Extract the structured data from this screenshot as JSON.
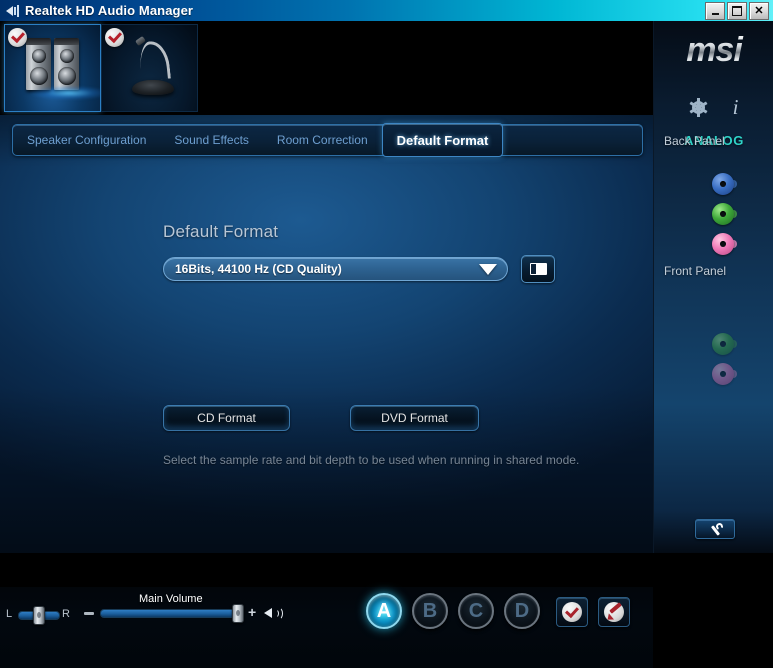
{
  "window": {
    "title": "Realtek HD Audio Manager",
    "icon": "speaker-icon",
    "controls": {
      "minimize": "_",
      "maximize": "□",
      "close": "✕"
    }
  },
  "device_tabs": [
    {
      "name": "speakers",
      "icon": "speakers-icon",
      "badge": "check-badge",
      "selected": true
    },
    {
      "name": "microphone",
      "icon": "microphone-icon",
      "badge": "check-badge",
      "selected": false
    }
  ],
  "tabs": [
    {
      "label": "Speaker Configuration",
      "active": false
    },
    {
      "label": "Sound Effects",
      "active": false
    },
    {
      "label": "Room Correction",
      "active": false
    },
    {
      "label": "Default Format",
      "active": true
    }
  ],
  "main": {
    "section_title": "Default Format",
    "format_select": {
      "value": "16Bits, 44100 Hz (CD Quality)",
      "caret": "chevron-down-icon"
    },
    "test_button": "test-tone-icon",
    "cd_format_label": "CD Format",
    "dvd_format_label": "DVD Format",
    "hint": "Select the sample rate and bit depth to be used when running in shared mode."
  },
  "bottom": {
    "balance": {
      "left_label": "L",
      "right_label": "R",
      "value": 50
    },
    "main_volume": {
      "label": "Main Volume",
      "minus": "minus-icon",
      "plus": "+",
      "speaker_icon": "volume-speaker-icon",
      "value": 100
    },
    "profiles": [
      {
        "label": "A",
        "active": true
      },
      {
        "label": "B",
        "active": false
      },
      {
        "label": "C",
        "active": false
      },
      {
        "label": "D",
        "active": false
      }
    ],
    "actions": [
      {
        "name": "apply",
        "icon": "check-disc-icon"
      },
      {
        "name": "edit",
        "icon": "pen-disc-icon"
      }
    ]
  },
  "sidebar": {
    "brand": "msi",
    "icons": [
      {
        "name": "gear-icon"
      },
      {
        "name": "info-icon",
        "glyph": "i"
      }
    ],
    "connector_type": "ANALOG",
    "back_panel_label": "Back Panel",
    "front_panel_label": "Front Panel",
    "back_panel_jacks": [
      {
        "name": "line-in-jack",
        "color": "#3a6fc4",
        "active": true
      },
      {
        "name": "line-out-jack",
        "color": "#3fa83a",
        "active": true
      },
      {
        "name": "mic-in-jack",
        "color": "#f07ab8",
        "active": true
      }
    ],
    "front_panel_jacks": [
      {
        "name": "front-line-out-jack",
        "color": "#3fa83a",
        "active": false
      },
      {
        "name": "front-mic-in-jack",
        "color": "#f07ab8",
        "active": false
      }
    ],
    "settings_button": "wrench-icon"
  },
  "colors": {
    "accent_cyan": "#2fd4c8",
    "panel_blue": "#14446d",
    "titlebar_start": "#00306b",
    "titlebar_end": "#63f0f8",
    "selected_tab_text": "#ffffff",
    "tab_text": "#6e9fd0"
  }
}
